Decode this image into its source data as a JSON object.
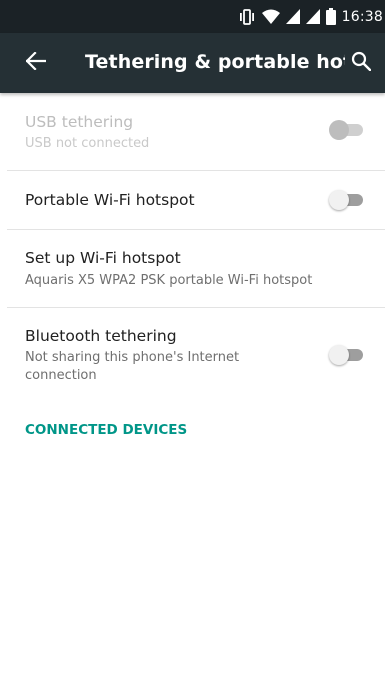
{
  "status_bar": {
    "time": "16:38",
    "icons": [
      "vibrate-icon",
      "wifi-icon",
      "signal-icon",
      "signal-icon",
      "battery-icon"
    ]
  },
  "toolbar": {
    "title": "Tethering & portable hot…",
    "back_icon": "arrow-back-icon",
    "search_icon": "search-icon"
  },
  "settings": [
    {
      "title": "USB tethering",
      "summary": "USB not connected",
      "enabled": false,
      "switch_on": false
    },
    {
      "title": "Portable Wi-Fi hotspot",
      "summary": "",
      "enabled": true,
      "switch_on": false
    },
    {
      "title": "Set up Wi-Fi hotspot",
      "summary": "Aquaris X5 WPA2 PSK portable Wi-Fi hotspot",
      "enabled": true
    },
    {
      "title": "Bluetooth tethering",
      "summary": "Not sharing this phone's Internet connection",
      "enabled": true,
      "switch_on": false
    }
  ],
  "section_header": "CONNECTED DEVICES",
  "colors": {
    "status_bar": "#1b2226",
    "toolbar": "#253035",
    "accent": "#009688"
  }
}
